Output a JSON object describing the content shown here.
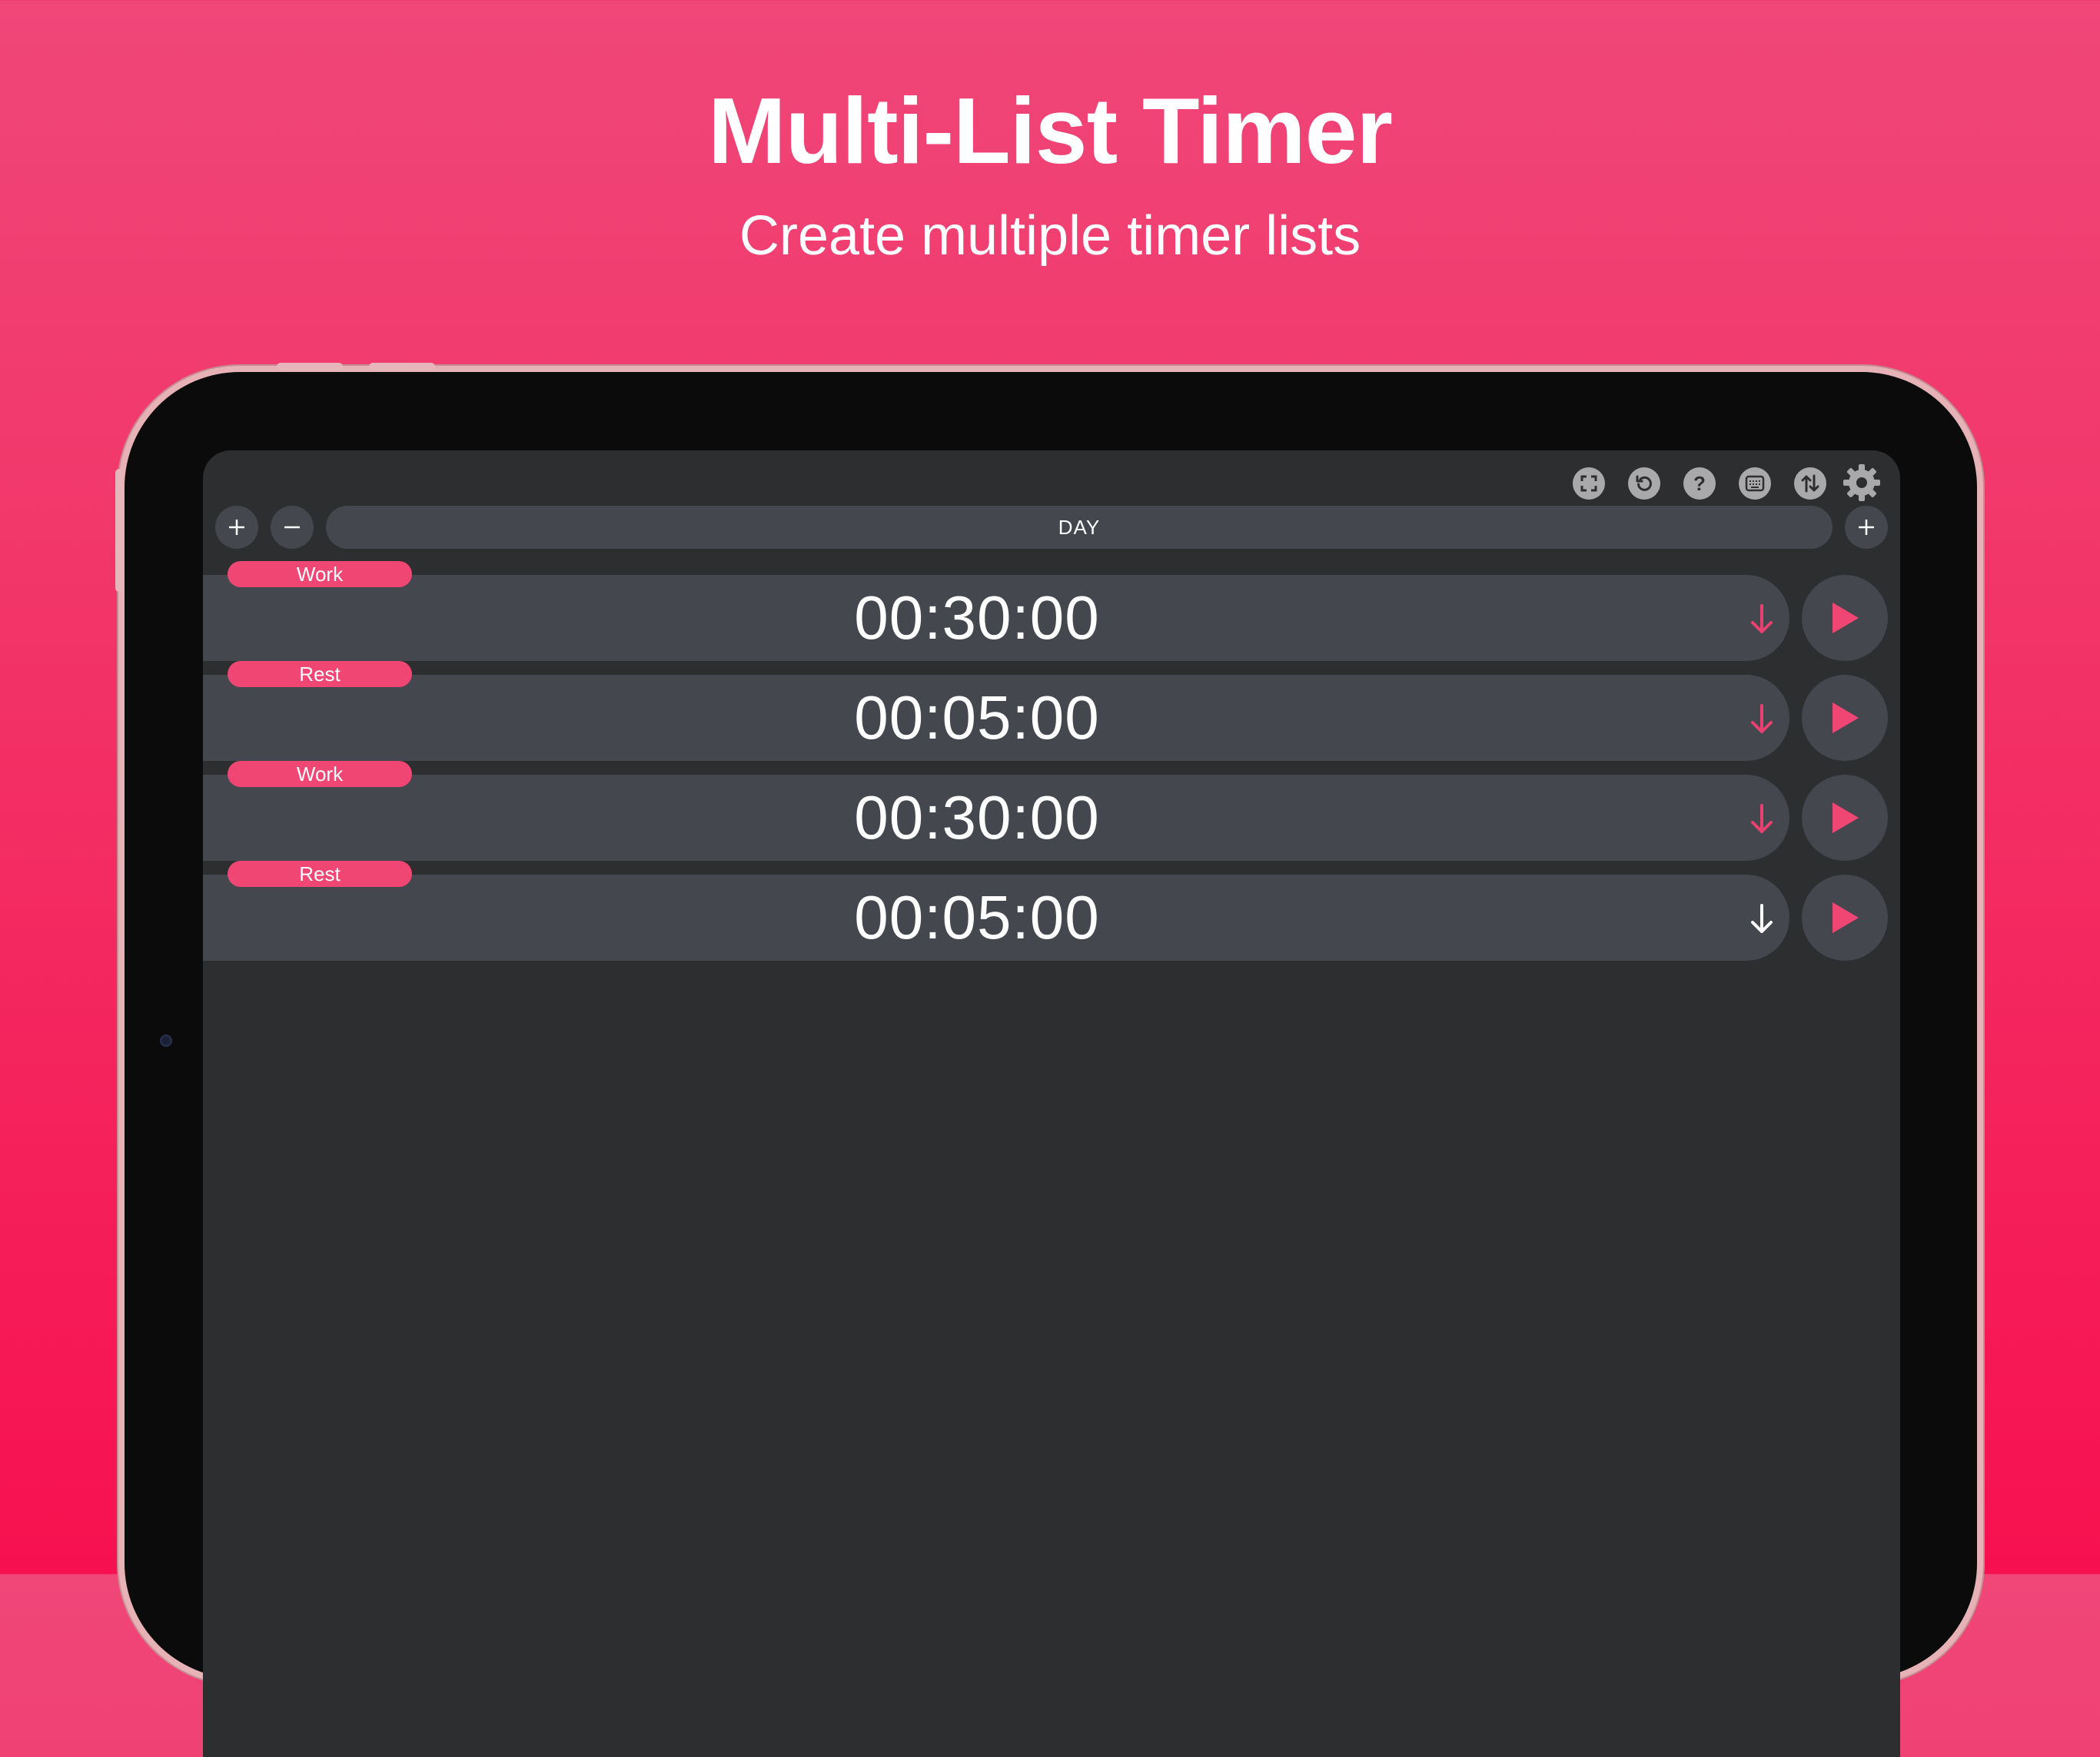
{
  "promo": {
    "title": "Multi-List Timer",
    "subtitle": "Create multiple timer lists"
  },
  "toolbar": {
    "icons": [
      "fullscreen-icon",
      "reset-icon",
      "help-icon",
      "keyboard-icon",
      "sort-icon",
      "gear-icon"
    ],
    "help_glyph": "?"
  },
  "list": {
    "name": "DAY"
  },
  "timers": [
    {
      "label": "Work",
      "time": "00:30:00",
      "arrow_color": "#e9416f"
    },
    {
      "label": "Rest",
      "time": "00:05:00",
      "arrow_color": "#e9416f"
    },
    {
      "label": "Work",
      "time": "00:30:00",
      "arrow_color": "#e9416f"
    },
    {
      "label": "Rest",
      "time": "00:05:00",
      "arrow_color": "#ffffff"
    }
  ],
  "colors": {
    "accent": "#f04673",
    "surface": "#44484e",
    "background": "#2d2e30"
  }
}
